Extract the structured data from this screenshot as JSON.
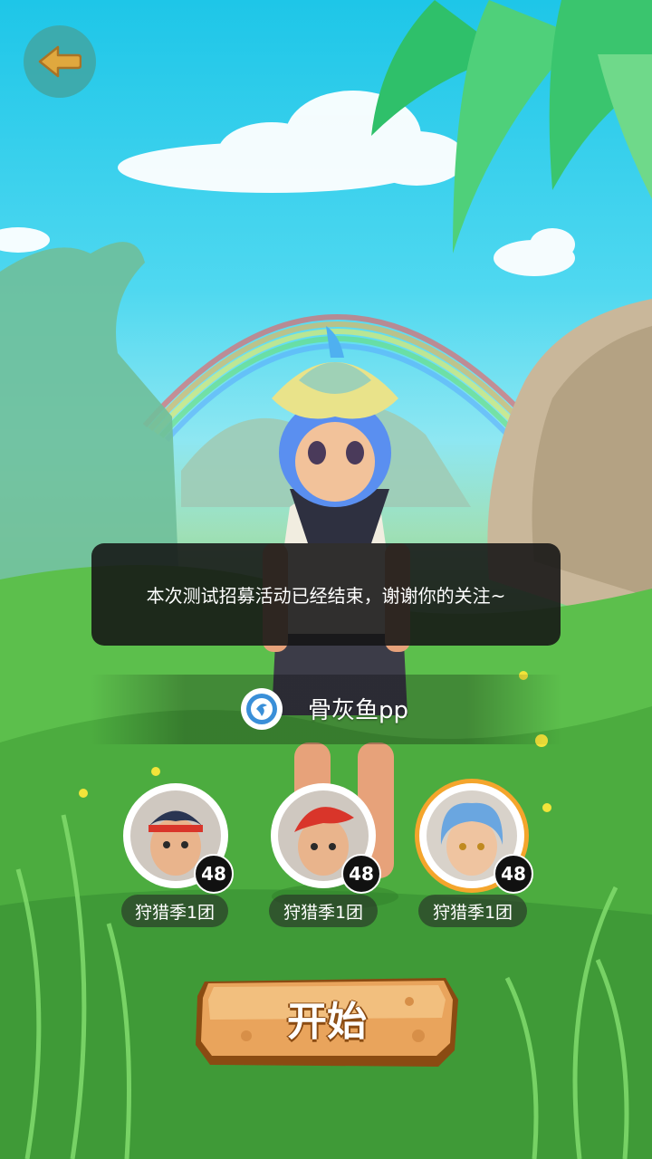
{
  "toast": {
    "message": "本次测试招募活动已经结束，谢谢你的关注~"
  },
  "user": {
    "name": "骨灰鱼pp",
    "icon": "badge-icon"
  },
  "characters": [
    {
      "level": "48",
      "team": "狩猎季1团",
      "hair": "#2a3552",
      "selected": false
    },
    {
      "level": "48",
      "team": "狩猎季1团",
      "hair": "#d9352a",
      "selected": false
    },
    {
      "level": "48",
      "team": "狩猎季1团",
      "hair": "#6aa6e0",
      "selected": true
    }
  ],
  "start_button": {
    "label": "开始"
  },
  "colors": {
    "accent": "#f4a52c",
    "button": "#e9a45c",
    "back": "#3fa8a8"
  }
}
